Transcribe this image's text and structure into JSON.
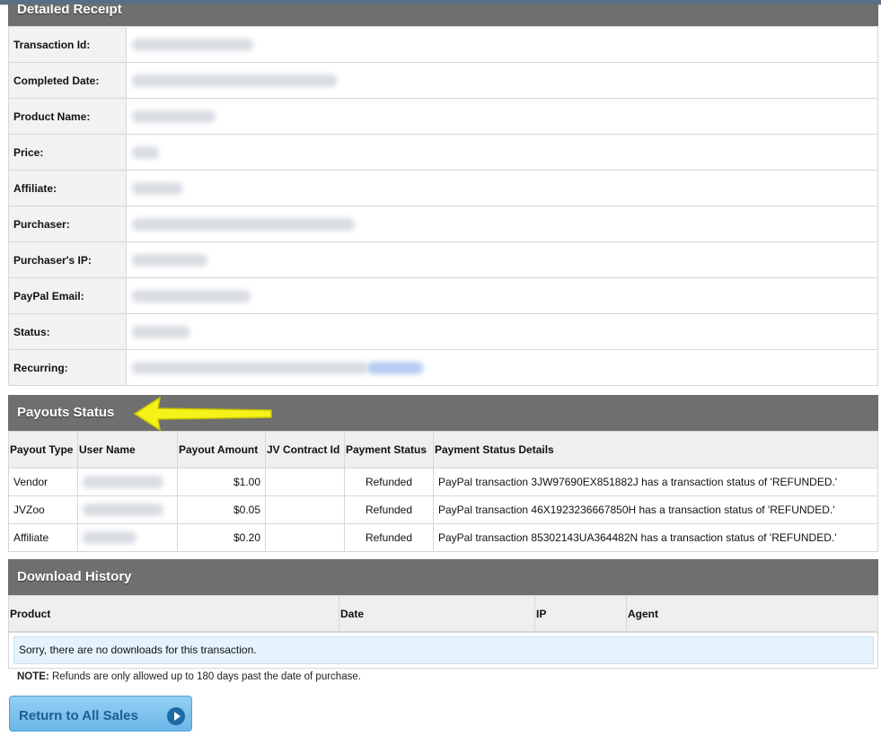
{
  "receipt": {
    "title": "Detailed Receipt",
    "rows": [
      {
        "label": "Transaction Id:"
      },
      {
        "label": "Completed Date:"
      },
      {
        "label": "Product Name:"
      },
      {
        "label": "Price:"
      },
      {
        "label": "Affiliate:"
      },
      {
        "label": "Purchaser:"
      },
      {
        "label": "Purchaser's IP:"
      },
      {
        "label": "PayPal Email:"
      },
      {
        "label": "Status:"
      },
      {
        "label": "Recurring:"
      }
    ]
  },
  "payouts": {
    "title": "Payouts Status",
    "columns": [
      "Payout Type",
      "User Name",
      "Payout Amount",
      "JV Contract Id",
      "Payment Status",
      "Payment Status Details"
    ],
    "rows": [
      {
        "type": "Vendor",
        "amount": "$1.00",
        "status": "Refunded",
        "details": "PayPal transaction 3JW97690EX851882J has a transaction status of 'REFUNDED.'"
      },
      {
        "type": "JVZoo",
        "amount": "$0.05",
        "status": "Refunded",
        "details": "PayPal transaction 46X1923236667850H has a transaction status of 'REFUNDED.'"
      },
      {
        "type": "Affiliate",
        "amount": "$0.20",
        "status": "Refunded",
        "details": "PayPal transaction 85302143UA364482N has a transaction status of 'REFUNDED.'"
      }
    ]
  },
  "downloads": {
    "title": "Download History",
    "columns": [
      "Product",
      "Date",
      "IP",
      "Agent"
    ],
    "empty_message": "Sorry, there are no downloads for this transaction."
  },
  "note": {
    "label": "NOTE:",
    "text": " Refunds are only allowed up to 180 days past the date of purchase."
  },
  "return_button": {
    "label": "Return to All Sales",
    "icon": "circle-arrow-right-icon"
  },
  "colors": {
    "section_header": "#6f6f6f",
    "button": "#7fc3ee",
    "annotation_arrow": "#f5f21a"
  }
}
